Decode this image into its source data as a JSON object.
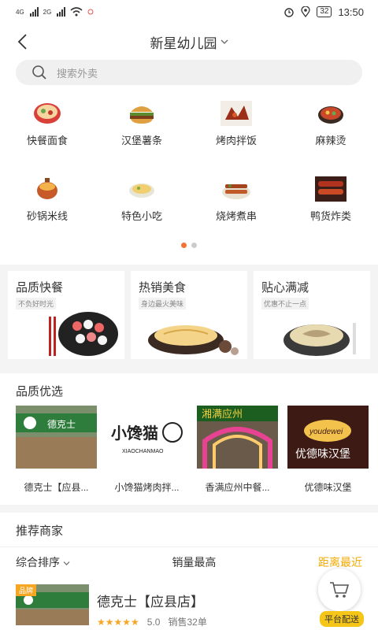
{
  "status_bar": {
    "sim1": "4G",
    "sim2": "2G",
    "battery": "32",
    "time": "13:50"
  },
  "header": {
    "title": "新星幼儿园"
  },
  "search": {
    "placeholder": "搜索外卖"
  },
  "categories": [
    {
      "label": "快餐面食",
      "icon": "noodle-bowl-icon"
    },
    {
      "label": "汉堡薯条",
      "icon": "burger-icon"
    },
    {
      "label": "烤肉拌饭",
      "icon": "bbq-meat-icon"
    },
    {
      "label": "麻辣烫",
      "icon": "hotpot-icon"
    },
    {
      "label": "砂锅米线",
      "icon": "clay-pot-icon"
    },
    {
      "label": "特色小吃",
      "icon": "snack-bowl-icon"
    },
    {
      "label": "烧烤煮串",
      "icon": "skewer-icon"
    },
    {
      "label": "鸭货炸类",
      "icon": "duck-neck-icon"
    }
  ],
  "promos": [
    {
      "title": "品质快餐",
      "sub": "不负好时光"
    },
    {
      "title": "热销美食",
      "sub": "身边最火美味"
    },
    {
      "title": "贴心满减",
      "sub": "优惠不止一点"
    }
  ],
  "quality_section": {
    "title": "品质优选",
    "items": [
      {
        "name": "德克士【应县...",
        "sign": "德克士"
      },
      {
        "name": "小馋猫烤肉拌...",
        "sign": "小馋猫"
      },
      {
        "name": "香满应州中餐...",
        "sign": "湘满应州"
      },
      {
        "name": "优德味汉堡",
        "sign": "优德味汉堡"
      }
    ]
  },
  "recommend": {
    "title": "推荐商家"
  },
  "sort_bar": {
    "sort1": "综合排序",
    "sort2": "销量最高",
    "sort3": "距离最近"
  },
  "merchant": {
    "name": "德克士【应县店】",
    "rating": "5.0",
    "sales": "销售32单",
    "brand_tag": "品牌",
    "delivery": "平台配送"
  },
  "colors": {
    "accent": "#f37335",
    "gold": "#f2a900",
    "star": "#f5a623"
  }
}
